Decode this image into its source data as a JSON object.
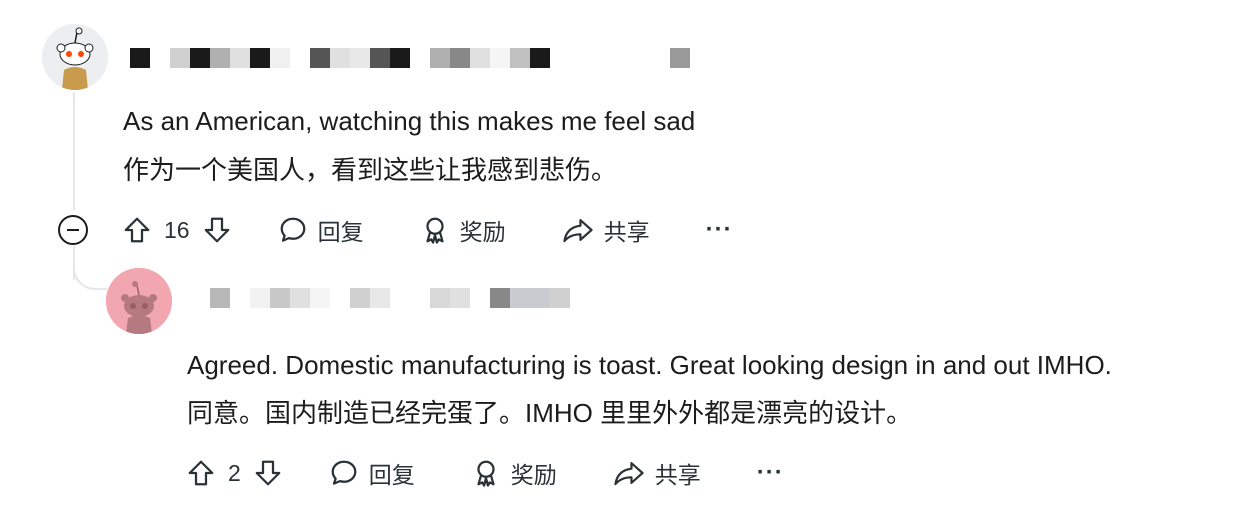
{
  "comments": [
    {
      "text_en": "As an American, watching this makes me feel sad",
      "text_zh": "作为一个美国人，看到这些让我感到悲伤。",
      "votes": "16",
      "reply_label": "回复",
      "award_label": "奖励",
      "share_label": "共享",
      "more_label": "···"
    },
    {
      "text_en": "Agreed. Domestic manufacturing is toast. Great looking design in and out IMHO.",
      "text_zh": "同意。国内制造已经完蛋了。IMHO 里里外外都是漂亮的设计。",
      "votes": "2",
      "reply_label": "回复",
      "award_label": "奖励",
      "share_label": "共享",
      "more_label": "···"
    }
  ],
  "icons": {
    "upvote": "arrow-up-icon",
    "downvote": "arrow-down-icon",
    "reply": "speech-bubble-icon",
    "award": "award-ribbon-icon",
    "share": "share-arrow-icon",
    "collapse": "minus-circle-icon"
  },
  "colors": {
    "text": "#1c1c1c",
    "thread_line": "#e5e7ea",
    "avatar2_bg": "#f2a7b0",
    "snoo_orange": "#ff4500"
  }
}
